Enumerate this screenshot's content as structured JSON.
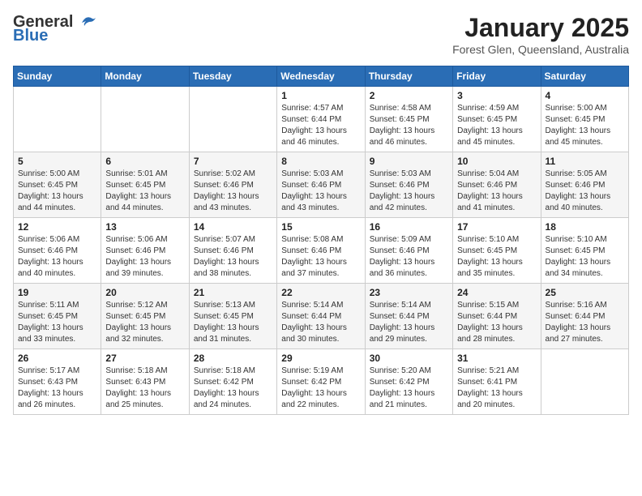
{
  "header": {
    "logo_general": "General",
    "logo_blue": "Blue",
    "month_year": "January 2025",
    "location": "Forest Glen, Queensland, Australia"
  },
  "weekdays": [
    "Sunday",
    "Monday",
    "Tuesday",
    "Wednesday",
    "Thursday",
    "Friday",
    "Saturday"
  ],
  "weeks": [
    [
      {
        "day": "",
        "info": ""
      },
      {
        "day": "",
        "info": ""
      },
      {
        "day": "",
        "info": ""
      },
      {
        "day": "1",
        "info": "Sunrise: 4:57 AM\nSunset: 6:44 PM\nDaylight: 13 hours\nand 46 minutes."
      },
      {
        "day": "2",
        "info": "Sunrise: 4:58 AM\nSunset: 6:45 PM\nDaylight: 13 hours\nand 46 minutes."
      },
      {
        "day": "3",
        "info": "Sunrise: 4:59 AM\nSunset: 6:45 PM\nDaylight: 13 hours\nand 45 minutes."
      },
      {
        "day": "4",
        "info": "Sunrise: 5:00 AM\nSunset: 6:45 PM\nDaylight: 13 hours\nand 45 minutes."
      }
    ],
    [
      {
        "day": "5",
        "info": "Sunrise: 5:00 AM\nSunset: 6:45 PM\nDaylight: 13 hours\nand 44 minutes."
      },
      {
        "day": "6",
        "info": "Sunrise: 5:01 AM\nSunset: 6:45 PM\nDaylight: 13 hours\nand 44 minutes."
      },
      {
        "day": "7",
        "info": "Sunrise: 5:02 AM\nSunset: 6:46 PM\nDaylight: 13 hours\nand 43 minutes."
      },
      {
        "day": "8",
        "info": "Sunrise: 5:03 AM\nSunset: 6:46 PM\nDaylight: 13 hours\nand 43 minutes."
      },
      {
        "day": "9",
        "info": "Sunrise: 5:03 AM\nSunset: 6:46 PM\nDaylight: 13 hours\nand 42 minutes."
      },
      {
        "day": "10",
        "info": "Sunrise: 5:04 AM\nSunset: 6:46 PM\nDaylight: 13 hours\nand 41 minutes."
      },
      {
        "day": "11",
        "info": "Sunrise: 5:05 AM\nSunset: 6:46 PM\nDaylight: 13 hours\nand 40 minutes."
      }
    ],
    [
      {
        "day": "12",
        "info": "Sunrise: 5:06 AM\nSunset: 6:46 PM\nDaylight: 13 hours\nand 40 minutes."
      },
      {
        "day": "13",
        "info": "Sunrise: 5:06 AM\nSunset: 6:46 PM\nDaylight: 13 hours\nand 39 minutes."
      },
      {
        "day": "14",
        "info": "Sunrise: 5:07 AM\nSunset: 6:46 PM\nDaylight: 13 hours\nand 38 minutes."
      },
      {
        "day": "15",
        "info": "Sunrise: 5:08 AM\nSunset: 6:46 PM\nDaylight: 13 hours\nand 37 minutes."
      },
      {
        "day": "16",
        "info": "Sunrise: 5:09 AM\nSunset: 6:46 PM\nDaylight: 13 hours\nand 36 minutes."
      },
      {
        "day": "17",
        "info": "Sunrise: 5:10 AM\nSunset: 6:45 PM\nDaylight: 13 hours\nand 35 minutes."
      },
      {
        "day": "18",
        "info": "Sunrise: 5:10 AM\nSunset: 6:45 PM\nDaylight: 13 hours\nand 34 minutes."
      }
    ],
    [
      {
        "day": "19",
        "info": "Sunrise: 5:11 AM\nSunset: 6:45 PM\nDaylight: 13 hours\nand 33 minutes."
      },
      {
        "day": "20",
        "info": "Sunrise: 5:12 AM\nSunset: 6:45 PM\nDaylight: 13 hours\nand 32 minutes."
      },
      {
        "day": "21",
        "info": "Sunrise: 5:13 AM\nSunset: 6:45 PM\nDaylight: 13 hours\nand 31 minutes."
      },
      {
        "day": "22",
        "info": "Sunrise: 5:14 AM\nSunset: 6:44 PM\nDaylight: 13 hours\nand 30 minutes."
      },
      {
        "day": "23",
        "info": "Sunrise: 5:14 AM\nSunset: 6:44 PM\nDaylight: 13 hours\nand 29 minutes."
      },
      {
        "day": "24",
        "info": "Sunrise: 5:15 AM\nSunset: 6:44 PM\nDaylight: 13 hours\nand 28 minutes."
      },
      {
        "day": "25",
        "info": "Sunrise: 5:16 AM\nSunset: 6:44 PM\nDaylight: 13 hours\nand 27 minutes."
      }
    ],
    [
      {
        "day": "26",
        "info": "Sunrise: 5:17 AM\nSunset: 6:43 PM\nDaylight: 13 hours\nand 26 minutes."
      },
      {
        "day": "27",
        "info": "Sunrise: 5:18 AM\nSunset: 6:43 PM\nDaylight: 13 hours\nand 25 minutes."
      },
      {
        "day": "28",
        "info": "Sunrise: 5:18 AM\nSunset: 6:42 PM\nDaylight: 13 hours\nand 24 minutes."
      },
      {
        "day": "29",
        "info": "Sunrise: 5:19 AM\nSunset: 6:42 PM\nDaylight: 13 hours\nand 22 minutes."
      },
      {
        "day": "30",
        "info": "Sunrise: 5:20 AM\nSunset: 6:42 PM\nDaylight: 13 hours\nand 21 minutes."
      },
      {
        "day": "31",
        "info": "Sunrise: 5:21 AM\nSunset: 6:41 PM\nDaylight: 13 hours\nand 20 minutes."
      },
      {
        "day": "",
        "info": ""
      }
    ]
  ]
}
